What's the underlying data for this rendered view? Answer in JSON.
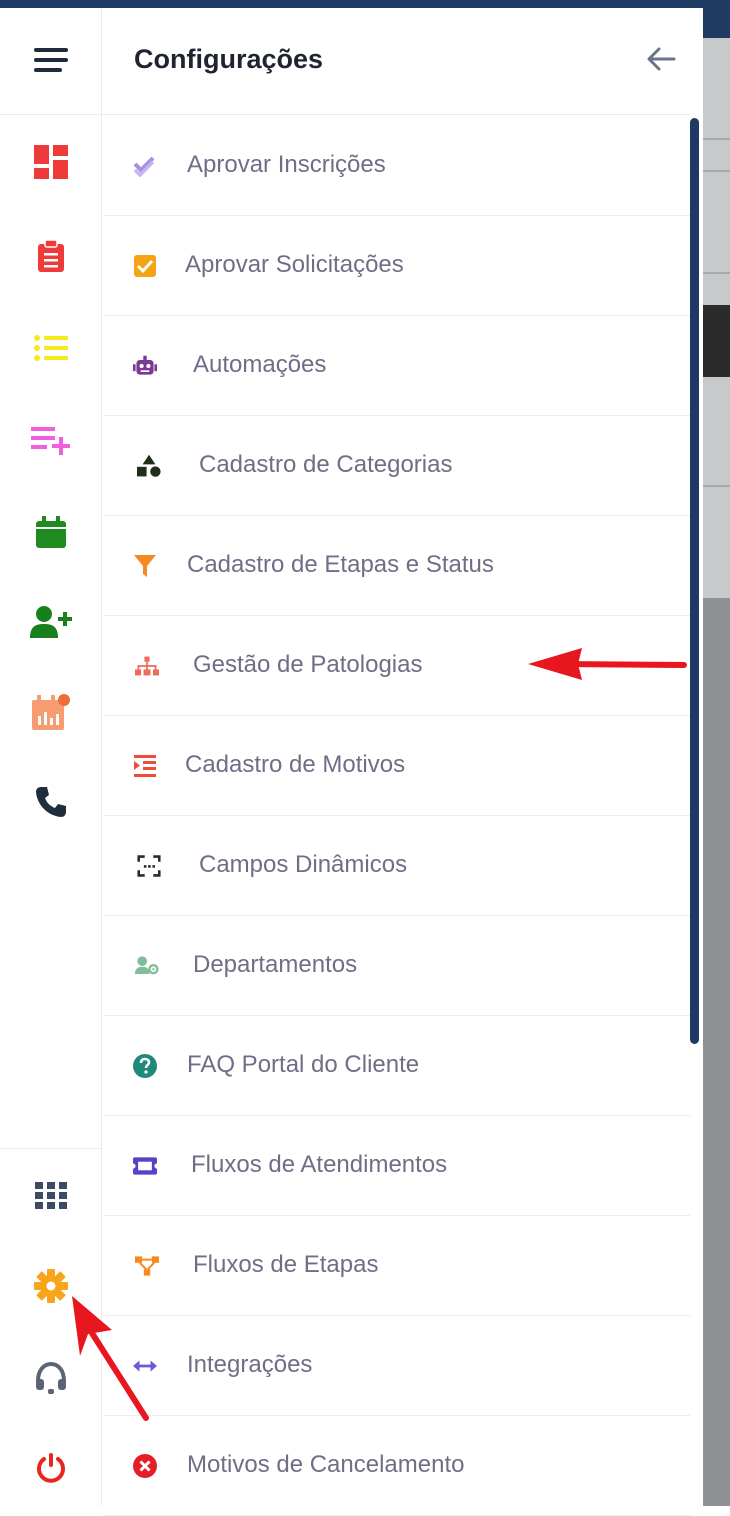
{
  "panel": {
    "title": "Configurações"
  },
  "rail": {
    "icons": [
      "hamburger-menu-icon",
      "dashboard-icon",
      "clipboard-icon",
      "list-icon",
      "playlist-add-icon",
      "calendar-icon",
      "add-user-icon",
      "calendar-chart-icon",
      "phone-icon",
      "apps-grid-icon",
      "gear-icon",
      "headset-icon",
      "power-icon"
    ]
  },
  "menu": {
    "items": [
      {
        "label": "Aprovar Inscrições",
        "icon": "double-check-icon",
        "color": "#a68ee4"
      },
      {
        "label": "Aprovar Solicitações",
        "icon": "checkbox-icon",
        "color": "#f6a313"
      },
      {
        "label": "Automações",
        "icon": "robot-icon",
        "color": "#7a3996"
      },
      {
        "label": "Cadastro de Categorias",
        "icon": "shapes-icon",
        "color": "#1f2f1a"
      },
      {
        "label": "Cadastro de Etapas e Status",
        "icon": "filter-icon",
        "color": "#f58a1f"
      },
      {
        "label": "Gestão de Patologias",
        "icon": "hierarchy-icon",
        "color": "#ef6a5a"
      },
      {
        "label": "Cadastro de Motivos",
        "icon": "indent-list-icon",
        "color": "#ef4b3a"
      },
      {
        "label": "Campos Dinâmicos",
        "icon": "dashed-frame-icon",
        "color": "#2b2b2b"
      },
      {
        "label": "Departamentos",
        "icon": "users-gear-icon",
        "color": "#7fbf9a"
      },
      {
        "label": "FAQ Portal do Cliente",
        "icon": "question-circle-icon",
        "color": "#1f8a7a"
      },
      {
        "label": "Fluxos de Atendimentos",
        "icon": "ticket-icon",
        "color": "#5b3fc6"
      },
      {
        "label": "Fluxos de Etapas",
        "icon": "flow-nodes-icon",
        "color": "#f58a1f"
      },
      {
        "label": "Integrações",
        "icon": "arrows-horizontal-icon",
        "color": "#6a5ad8"
      },
      {
        "label": "Motivos de Cancelamento",
        "icon": "cancel-circle-icon",
        "color": "#e51f2a"
      }
    ]
  },
  "colors": {
    "accent": "#1e3a64",
    "annotation": "#e8161f",
    "text": "#6f6e86"
  }
}
